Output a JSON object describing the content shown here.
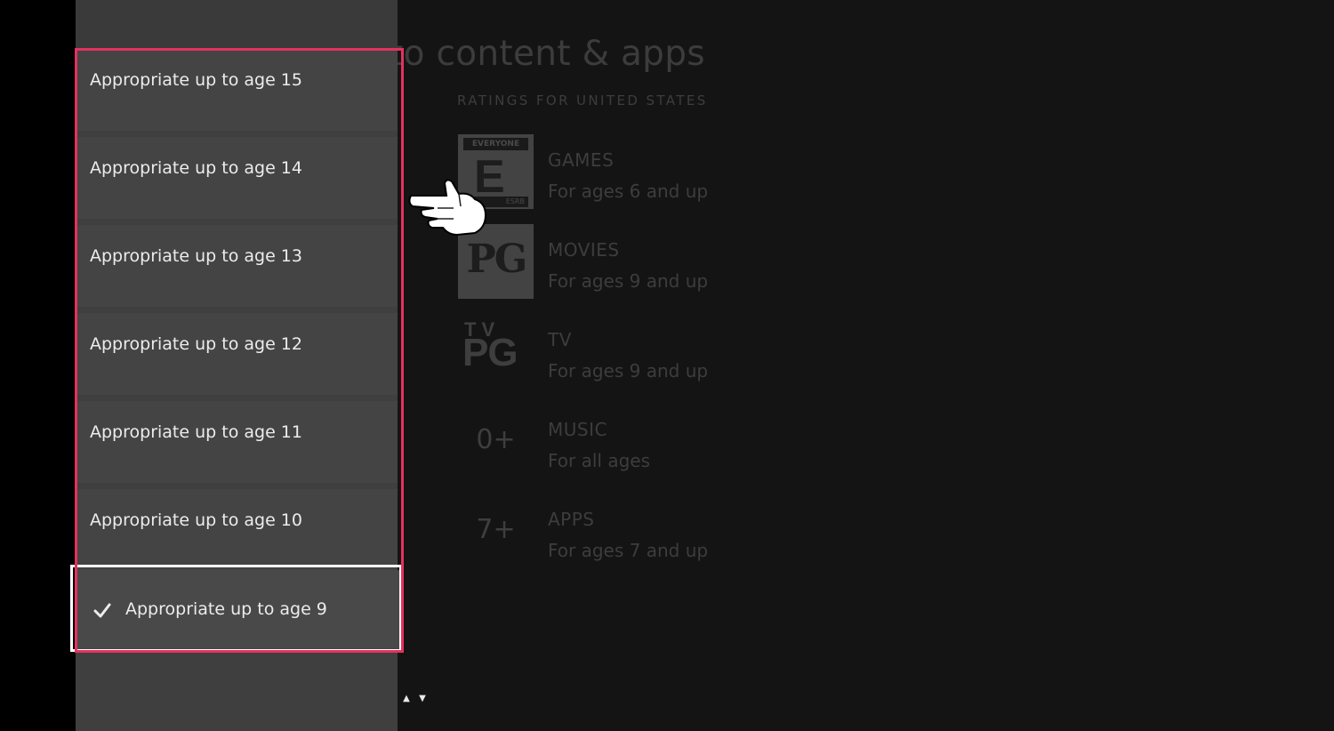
{
  "background": {
    "page_title": "Access to content & apps",
    "ratings_heading": "RATINGS FOR UNITED STATES",
    "ratings": [
      {
        "badge_type": "esrb",
        "badge_top": "EVERYONE",
        "badge_letter": "E",
        "badge_bottom": "ESRB",
        "category": "GAMES",
        "description": "For ages 6 and up"
      },
      {
        "badge_type": "mpaa",
        "badge_text": "PG",
        "category": "MOVIES",
        "description": "For ages 9 and up"
      },
      {
        "badge_type": "tv",
        "badge_top": "TV",
        "badge_text": "PG",
        "category": "TV",
        "description": "For ages 9 and up"
      },
      {
        "badge_type": "age",
        "badge_text": "0+",
        "category": "MUSIC",
        "description": "For all ages"
      },
      {
        "badge_type": "age",
        "badge_text": "7+",
        "category": "APPS",
        "description": "For ages 7 and up"
      }
    ]
  },
  "dropdown": {
    "options": [
      {
        "label": "Appropriate up to age 15"
      },
      {
        "label": "Appropriate up to age 14"
      },
      {
        "label": "Appropriate up to age 13"
      },
      {
        "label": "Appropriate up to age 12"
      },
      {
        "label": "Appropriate up to age 11"
      },
      {
        "label": "Appropriate up to age 10"
      }
    ],
    "selected": {
      "label": "Appropriate up to age 9"
    },
    "scroll_up": "▲",
    "scroll_down": "▼"
  },
  "colors": {
    "highlight": "#e2325f",
    "focus_outline": "#ffffff",
    "panel": "#444444"
  },
  "icons": {
    "check": "check-icon",
    "cursor": "hand-pointer-icon"
  }
}
